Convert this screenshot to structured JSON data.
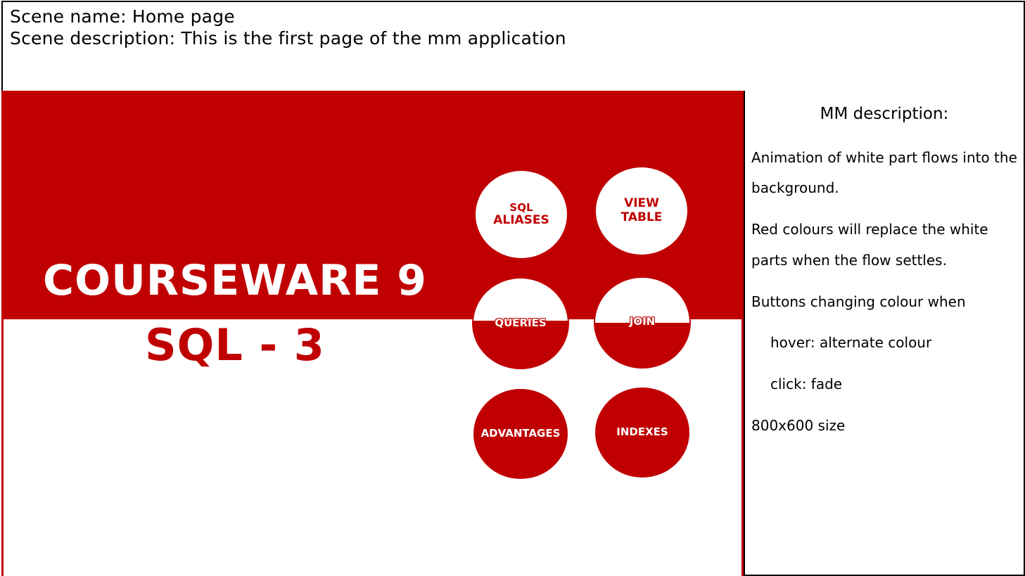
{
  "scene": {
    "name_line": "Scene name: Home page",
    "description_line": "Scene description: This is the first page of the mm application"
  },
  "mockup": {
    "title_main": "COURSEWARE 9",
    "title_sub": "SQL - 3",
    "buttons": [
      {
        "label_line1": "SQL",
        "label_line2": "ALIASES",
        "style": "white"
      },
      {
        "label_line1": "VIEW",
        "label_line2": "TABLE",
        "style": "white"
      },
      {
        "label": "QUERIES",
        "style": "split"
      },
      {
        "label": "JOIN",
        "style": "split"
      },
      {
        "label": "ADVANTAGES",
        "style": "red"
      },
      {
        "label": "INDEXES",
        "style": "red"
      }
    ],
    "colors": {
      "accent": "#c00000",
      "background": "#ffffff"
    }
  },
  "mm_description": {
    "title": "MM description:",
    "lines": [
      "Animation of white part flows into the",
      "background.",
      "Red colours will replace the white",
      "parts when the flow settles.",
      "Buttons changing colour when",
      "hover: alternate colour",
      "click: fade",
      "800x600 size"
    ]
  }
}
